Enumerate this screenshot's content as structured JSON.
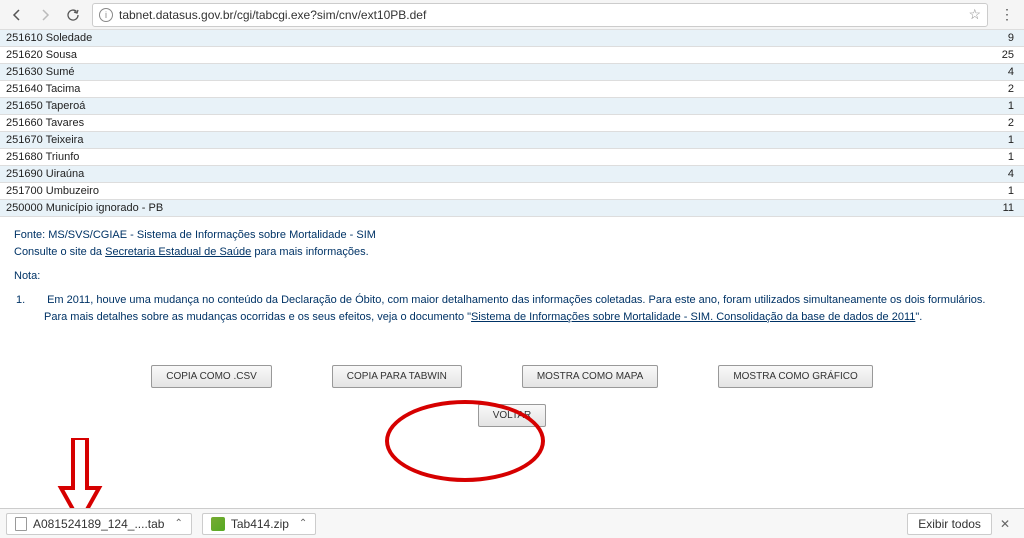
{
  "browser": {
    "url": "tabnet.datasus.gov.br/cgi/tabcgi.exe?sim/cnv/ext10PB.def"
  },
  "rows": [
    {
      "label": "251610 Soledade",
      "value": "9"
    },
    {
      "label": "251620 Sousa",
      "value": "25"
    },
    {
      "label": "251630 Sumé",
      "value": "4"
    },
    {
      "label": "251640 Tacima",
      "value": "2"
    },
    {
      "label": "251650 Taperoá",
      "value": "1"
    },
    {
      "label": "251660 Tavares",
      "value": "2"
    },
    {
      "label": "251670 Teixeira",
      "value": "1"
    },
    {
      "label": "251680 Triunfo",
      "value": "1"
    },
    {
      "label": "251690 Uiraúna",
      "value": "4"
    },
    {
      "label": "251700 Umbuzeiro",
      "value": "1"
    },
    {
      "label": "250000 Município ignorado - PB",
      "value": "11"
    }
  ],
  "source": {
    "line1_prefix": "Fonte: MS/SVS/CGIAE - Sistema de Informações sobre Mortalidade - SIM",
    "line2_prefix": "Consulte o site da ",
    "line2_link": "Secretaria Estadual de Saúde",
    "line2_suffix": " para mais informações."
  },
  "nota": {
    "label": "Nota:",
    "num": "1.",
    "text_prefix": "Em 2011, houve uma mudança no conteúdo da Declaração de Óbito, com maior detalhamento das informações coletadas. Para este ano, foram utilizados simultaneamente os dois formulários. Para mais detalhes sobre as mudanças ocorridas e os seus efeitos, veja o documento \"",
    "text_link": "Sistema de Informações sobre Mortalidade - SIM. Consolidação da base de dados de 2011",
    "text_suffix": "\"."
  },
  "buttons": {
    "copia_csv": "COPIA COMO .CSV",
    "copia_tabwin": "COPIA PARA TABWIN",
    "mostra_mapa": "MOSTRA COMO MAPA",
    "mostra_grafico": "MOSTRA COMO GRÁFICO",
    "voltar": "VOLTAR"
  },
  "downloads": {
    "file1": "A081524189_124_....tab",
    "file2": "Tab414.zip",
    "show_all": "Exibir todos"
  }
}
